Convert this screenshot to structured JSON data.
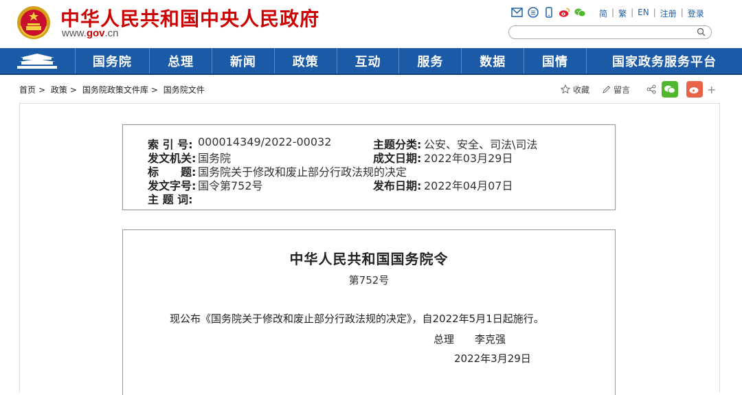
{
  "header": {
    "site_title": "中华人民共和国中央人民政府",
    "url_prefix": "www.",
    "url_brand": "gov",
    "url_suffix": ".cn",
    "icons": [
      "mail-icon",
      "rss-icon",
      "mobile-icon",
      "weibo-icon",
      "wechat-icon"
    ],
    "links": [
      "简",
      "繁",
      "EN",
      "注册",
      "登录"
    ],
    "search_placeholder": ""
  },
  "nav": {
    "items": [
      "国务院",
      "总理",
      "新闻",
      "政策",
      "互动",
      "服务",
      "数据",
      "国情",
      "国家政务服务平台"
    ]
  },
  "breadcrumb": [
    "首页",
    "政策",
    "国务院政策文件库",
    "国务院文件"
  ],
  "tools": {
    "favorite": "收藏",
    "comment": "留言",
    "more": "+"
  },
  "meta": {
    "index_label": "索 引 号:",
    "index_value": "000014349/2022-00032",
    "topic_label": "主题分类:",
    "topic_value": "公安、安全、司法\\司法",
    "issuer_label": "发文机关:",
    "issuer_value": "国务院",
    "date_label": "成文日期:",
    "date_value": "2022年03月29日",
    "title_label": "标　　题:",
    "title_value": "国务院关于修改和废止部分行政法规的决定",
    "docno_label": "发文字号:",
    "docno_value": "国令第752号",
    "pubdate_label": "发布日期:",
    "pubdate_value": "2022年04月07日",
    "keywords_label": "主 题 词:",
    "keywords_value": ""
  },
  "document": {
    "title": "中华人民共和国国务院令",
    "number": "第752号",
    "body": "现公布《国务院关于修改和废止部分行政法规的决定》，自2022年5月1日起施行。",
    "signer_title": "总理",
    "signer_name": "李克强",
    "date": "2022年3月29日"
  },
  "colors": {
    "brand_red": "#cc0000",
    "nav_blue": "#1b5aa6"
  }
}
